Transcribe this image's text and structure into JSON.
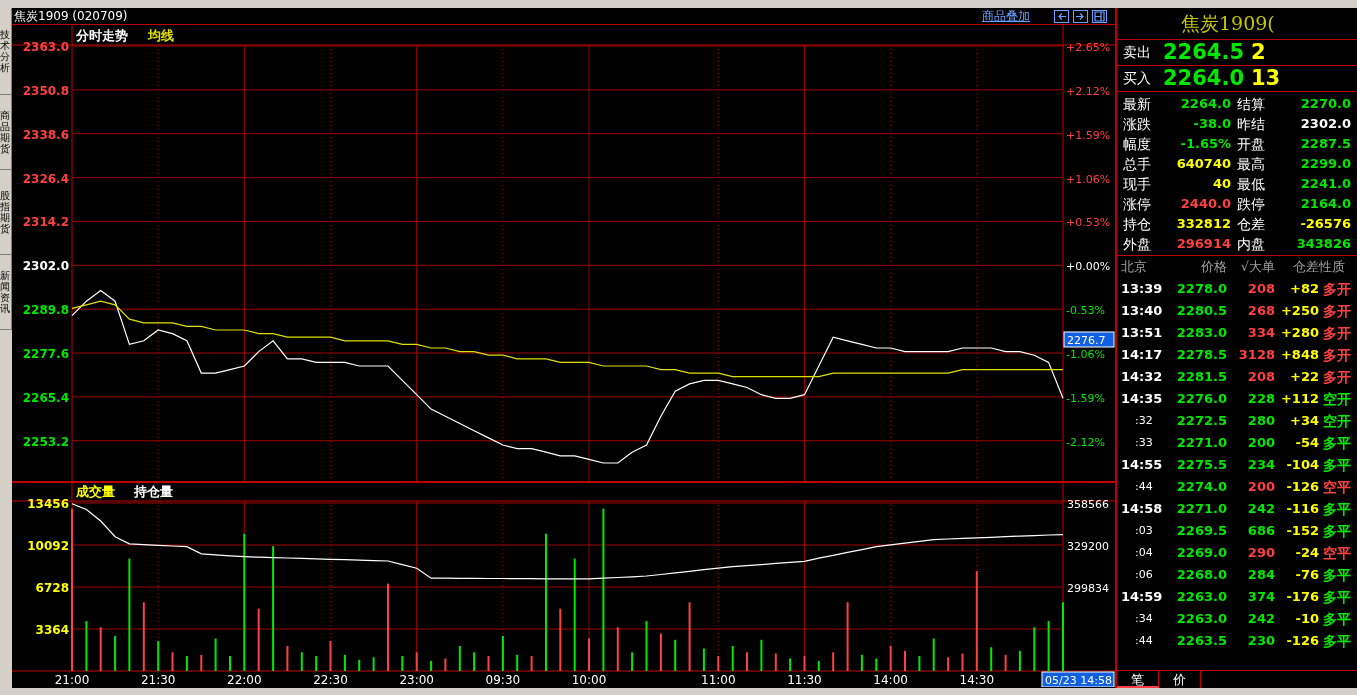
{
  "side_tabs": [
    {
      "label": "技术分析"
    },
    {
      "label": "商品期货"
    },
    {
      "label": "股指期货"
    },
    {
      "label": "新闻资讯"
    }
  ],
  "header": {
    "title": "焦炭1909 (020709)",
    "overlay_link": "商品叠加"
  },
  "price_panel": {
    "percent_labels": [
      {
        "text": "+2.65%",
        "color": "#ff4040"
      },
      {
        "text": "+2.12%",
        "color": "#ff4040"
      },
      {
        "text": "+1.59%",
        "color": "#ff4040"
      },
      {
        "text": "+1.06%",
        "color": "#ff4040"
      },
      {
        "text": "+0.53%",
        "color": "#ff4040"
      },
      {
        "text": "+0.00%",
        "color": "#ffffff"
      },
      {
        "text": "-0.53%",
        "color": "#00e800"
      },
      {
        "text": "-1.06%",
        "color": "#00e800"
      },
      {
        "text": "-1.59%",
        "color": "#00e800"
      },
      {
        "text": "-2.12%",
        "color": "#00e800"
      }
    ],
    "last_price_tag": "2276.7",
    "chart_data": {
      "type": "line",
      "title": "分时走势",
      "grid": true,
      "categories": [
        null,
        null,
        null,
        null,
        null,
        null,
        null,
        null,
        null,
        null,
        null,
        null,
        null,
        null,
        null,
        null,
        null,
        null,
        null,
        null,
        null,
        null,
        null,
        null,
        null,
        null,
        null,
        null,
        null,
        null,
        null,
        null,
        null,
        null,
        null,
        null,
        null,
        null,
        null,
        null,
        null,
        null,
        null,
        null,
        null,
        null,
        null,
        null,
        null,
        null,
        null,
        null,
        null,
        null,
        null,
        null,
        null,
        null,
        null,
        null,
        null,
        null,
        null,
        null,
        null,
        null,
        null,
        null,
        null,
        null
      ],
      "series": [
        {
          "color": "#ffffff",
          "values": [
            2288,
            2292,
            2295,
            2292,
            2280,
            2281,
            2284,
            2283,
            2281,
            2272,
            2272,
            2273,
            2274,
            2278,
            2281,
            2276,
            2276,
            2275,
            2275,
            2275,
            2274,
            2274,
            2274,
            2270,
            2266,
            2262,
            2260,
            2258,
            2256,
            2254,
            2252,
            2251,
            2251,
            2250,
            2249,
            2249,
            2248,
            2247,
            2247,
            2250,
            2252,
            2260,
            2267,
            2269,
            2270,
            2270,
            2269,
            2268,
            2266,
            2265,
            2265,
            2266,
            2274,
            2282,
            2281,
            2280,
            2279,
            2279,
            2278,
            2278,
            2278,
            2278,
            2279,
            2279,
            2279,
            2278,
            2278,
            2277,
            2275,
            2265
          ]
        },
        {
          "name": "均线",
          "color": "#e0e000",
          "values": [
            2290,
            2291,
            2292,
            2291,
            2287,
            2286,
            2286,
            2286,
            2285,
            2285,
            2284,
            2284,
            2284,
            2283,
            2283,
            2282,
            2282,
            2282,
            2282,
            2281,
            2281,
            2281,
            2281,
            2280,
            2280,
            2279,
            2279,
            2278,
            2278,
            2277,
            2277,
            2276,
            2276,
            2276,
            2275,
            2275,
            2275,
            2274,
            2274,
            2274,
            2274,
            2273,
            2273,
            2272,
            2272,
            2272,
            2271,
            2271,
            2271,
            2271,
            2271,
            2271,
            2271,
            2272,
            2272,
            2272,
            2272,
            2272,
            2272,
            2272,
            2272,
            2272,
            2273,
            2273,
            2273,
            2273,
            2273,
            2273,
            2273,
            2273
          ]
        }
      ],
      "ylim": [
        2242,
        2363
      ],
      "yticks": [
        {
          "value": 2363.0,
          "label": "2363.0"
        },
        {
          "value": 2350.8,
          "label": "2350.8"
        },
        {
          "value": 2338.6,
          "label": "2338.6"
        },
        {
          "value": 2326.4,
          "label": "2326.4"
        },
        {
          "value": 2314.2,
          "label": "2314.2"
        },
        {
          "value": 2302.0,
          "label": "2302.0"
        },
        {
          "value": 2289.8,
          "label": "2289.8"
        },
        {
          "value": 2277.6,
          "label": "2277.6"
        },
        {
          "value": 2265.4,
          "label": "2265.4"
        },
        {
          "value": 2253.2,
          "label": "2253.2"
        }
      ]
    }
  },
  "volume_panel": {
    "time_tag": "05/23 14:58",
    "chart_data": {
      "type": "bar",
      "title": "成交量",
      "grid": true,
      "categories": [
        "21:00",
        null,
        null,
        null,
        null,
        null,
        "21:30",
        null,
        null,
        null,
        null,
        null,
        "22:00",
        null,
        null,
        null,
        null,
        null,
        "22:30",
        null,
        null,
        null,
        null,
        null,
        "23:00",
        null,
        null,
        null,
        null,
        null,
        "09:30",
        null,
        null,
        null,
        null,
        null,
        "10:00",
        null,
        null,
        null,
        null,
        null,
        null,
        null,
        null,
        "11:00",
        null,
        null,
        null,
        null,
        null,
        "11:30",
        null,
        null,
        null,
        null,
        null,
        "14:00",
        null,
        null,
        null,
        null,
        null,
        "14:30",
        null,
        null,
        null,
        null,
        null,
        null
      ],
      "series": [
        {
          "color": "#ff4040",
          "values": [
            13000,
            null,
            3500,
            null,
            null,
            5500,
            null,
            1500,
            null,
            1300,
            null,
            null,
            null,
            5000,
            null,
            2000,
            null,
            null,
            2400,
            null,
            null,
            null,
            7000,
            null,
            1500,
            null,
            1000,
            null,
            null,
            1200,
            null,
            null,
            1200,
            null,
            5000,
            null,
            2600,
            null,
            3500,
            null,
            null,
            3000,
            null,
            5500,
            null,
            1200,
            null,
            1500,
            null,
            1400,
            null,
            1200,
            null,
            1500,
            5500,
            null,
            null,
            2000,
            1600,
            null,
            null,
            1100,
            1400,
            8000,
            null,
            1300,
            null,
            null,
            null,
            null
          ]
        },
        {
          "color": "#00e800",
          "values": [
            null,
            4000,
            null,
            2800,
            9000,
            null,
            2400,
            null,
            1200,
            null,
            2600,
            1200,
            11000,
            null,
            10000,
            null,
            1500,
            1200,
            null,
            1300,
            900,
            1100,
            null,
            1200,
            null,
            800,
            null,
            2000,
            1500,
            null,
            2800,
            1300,
            null,
            11000,
            null,
            9000,
            null,
            13000,
            null,
            1500,
            4000,
            null,
            2500,
            null,
            1800,
            null,
            2000,
            null,
            2500,
            null,
            1000,
            null,
            800,
            null,
            null,
            1300,
            1000,
            null,
            null,
            1200,
            2600,
            null,
            null,
            null,
            1900,
            null,
            1600,
            3500,
            4000,
            5500
          ]
        }
      ],
      "ylim": [
        0,
        13456
      ],
      "yticks": [
        {
          "value": 13456,
          "label": "13456"
        },
        {
          "value": 10092,
          "label": "10092"
        },
        {
          "value": 6728,
          "label": "6728"
        },
        {
          "value": 3364,
          "label": "3364"
        }
      ]
    },
    "open_interest": {
      "chart_data": {
        "type": "line",
        "categories": [
          null,
          null,
          null,
          null,
          null,
          null,
          null,
          null,
          null,
          null,
          null,
          null,
          null,
          null,
          null,
          null,
          null,
          null,
          null,
          null,
          null,
          null,
          null,
          null,
          null,
          null,
          null,
          null,
          null,
          null,
          null,
          null,
          null,
          null,
          null,
          null,
          null,
          null,
          null,
          null,
          null,
          null,
          null,
          null,
          null,
          null,
          null,
          null,
          null,
          null,
          null,
          null,
          null,
          null,
          null,
          null,
          null,
          null,
          null,
          null,
          null,
          null,
          null,
          null,
          null,
          null,
          null,
          null,
          null,
          null
        ],
        "series": [
          {
            "name": "持仓量",
            "color": "#ffffff",
            "values": [
              358000,
              354000,
              346000,
              335000,
              330000,
              329500,
              329000,
              328500,
              328000,
              323000,
              322300,
              321600,
              321000,
              320700,
              320400,
              320100,
              319800,
              319500,
              319200,
              318900,
              318600,
              318300,
              318000,
              315500,
              313000,
              306000,
              306000,
              305900,
              305900,
              305800,
              305800,
              305700,
              305700,
              305600,
              305600,
              305500,
              305500,
              306000,
              306500,
              307000,
              307500,
              308600,
              309700,
              310800,
              311900,
              313000,
              314000,
              314800,
              315500,
              316300,
              317000,
              317800,
              320000,
              322000,
              324000,
              326000,
              328000,
              329300,
              330500,
              331800,
              333000,
              333400,
              333800,
              334200,
              334600,
              335000,
              335400,
              335800,
              336200,
              336500
            ]
          }
        ],
        "ylim": [
          299834,
          358566
        ],
        "yticks": [
          {
            "value": 358566,
            "label": "358566"
          },
          {
            "value": 329200,
            "label": "329200"
          },
          {
            "value": 299834,
            "label": "299834"
          }
        ]
      }
    }
  },
  "quote": {
    "title": "焦炭1909(",
    "sell": {
      "label": "卖出",
      "price": "2264.5",
      "volume": "2"
    },
    "buy": {
      "label": "买入",
      "price": "2264.0",
      "volume": "13"
    },
    "stats": [
      {
        "label": "最新",
        "value": "2264.0",
        "color": "#00e800"
      },
      {
        "label": "结算",
        "value": "2270.0",
        "color": "#00e800"
      },
      {
        "label": "涨跌",
        "value": "-38.0",
        "color": "#00e800"
      },
      {
        "label": "昨结",
        "value": "2302.0",
        "color": "#ffffff"
      },
      {
        "label": "幅度",
        "value": "-1.65%",
        "color": "#00e800"
      },
      {
        "label": "开盘",
        "value": "2287.5",
        "color": "#00e800"
      },
      {
        "label": "总手",
        "value": "640740",
        "color": "#ffff00"
      },
      {
        "label": "最高",
        "value": "2299.0",
        "color": "#00e800"
      },
      {
        "label": "现手",
        "value": "40",
        "color": "#ffff00"
      },
      {
        "label": "最低",
        "value": "2241.0",
        "color": "#00e800"
      },
      {
        "label": "涨停",
        "value": "2440.0",
        "color": "#ff4040"
      },
      {
        "label": "跌停",
        "value": "2164.0",
        "color": "#00e800"
      },
      {
        "label": "持仓",
        "value": "332812",
        "color": "#ffff00"
      },
      {
        "label": "仓差",
        "value": "-26576",
        "color": "#ffff00"
      },
      {
        "label": "外盘",
        "value": "296914",
        "color": "#ff4040"
      },
      {
        "label": "内盘",
        "value": "343826",
        "color": "#00e800"
      }
    ]
  },
  "trades": {
    "columns": [
      "北京",
      "价格",
      "√大单",
      "仓差",
      "性质"
    ],
    "rows": [
      {
        "kind": "minute",
        "time": "13:39",
        "price": "2278.0",
        "volume": "208",
        "oi_change": "+82",
        "nature": "多开",
        "color": "#ff4040"
      },
      {
        "kind": "minute",
        "time": "13:40",
        "price": "2280.5",
        "volume": "268",
        "oi_change": "+250",
        "nature": "多开",
        "color": "#ff4040"
      },
      {
        "kind": "minute",
        "time": "13:51",
        "price": "2283.0",
        "volume": "334",
        "oi_change": "+280",
        "nature": "多开",
        "color": "#ff4040"
      },
      {
        "kind": "minute",
        "time": "14:17",
        "price": "2278.5",
        "volume": "3128",
        "oi_change": "+848",
        "nature": "多开",
        "color": "#ff4040"
      },
      {
        "kind": "minute",
        "time": "14:32",
        "price": "2281.5",
        "volume": "208",
        "oi_change": "+22",
        "nature": "多开",
        "color": "#ff4040"
      },
      {
        "kind": "minute",
        "time": "14:35",
        "price": "2276.0",
        "volume": "228",
        "oi_change": "+112",
        "nature": "空开",
        "color": "#00e800"
      },
      {
        "kind": "second",
        "time": ":32",
        "price": "2272.5",
        "volume": "280",
        "oi_change": "+34",
        "nature": "空开",
        "color": "#00e800"
      },
      {
        "kind": "second",
        "time": ":33",
        "price": "2271.0",
        "volume": "200",
        "oi_change": "-54",
        "nature": "多平",
        "color": "#00e800"
      },
      {
        "kind": "minute",
        "time": "14:55",
        "price": "2275.5",
        "volume": "234",
        "oi_change": "-104",
        "nature": "多平",
        "color": "#00e800"
      },
      {
        "kind": "second",
        "time": ":44",
        "price": "2274.0",
        "volume": "200",
        "oi_change": "-126",
        "nature": "空平",
        "color": "#ff4040"
      },
      {
        "kind": "minute",
        "time": "14:58",
        "price": "2271.0",
        "volume": "242",
        "oi_change": "-116",
        "nature": "多平",
        "color": "#00e800"
      },
      {
        "kind": "second",
        "time": ":03",
        "price": "2269.5",
        "volume": "686",
        "oi_change": "-152",
        "nature": "多平",
        "color": "#00e800"
      },
      {
        "kind": "second",
        "time": ":04",
        "price": "2269.0",
        "volume": "290",
        "oi_change": "-24",
        "nature": "空平",
        "color": "#ff4040"
      },
      {
        "kind": "second",
        "time": ":06",
        "price": "2268.0",
        "volume": "284",
        "oi_change": "-76",
        "nature": "多平",
        "color": "#00e800"
      },
      {
        "kind": "minute",
        "time": "14:59",
        "price": "2263.0",
        "volume": "374",
        "oi_change": "-176",
        "nature": "多平",
        "color": "#00e800"
      },
      {
        "kind": "second",
        "time": ":34",
        "price": "2263.0",
        "volume": "242",
        "oi_change": "-10",
        "nature": "多平",
        "color": "#00e800"
      },
      {
        "kind": "second",
        "time": ":44",
        "price": "2263.5",
        "volume": "230",
        "oi_change": "-126",
        "nature": "多平",
        "color": "#00e800"
      }
    ]
  },
  "bottom_tabs": [
    {
      "label": "笔",
      "selected": true
    },
    {
      "label": "价",
      "selected": false
    }
  ]
}
